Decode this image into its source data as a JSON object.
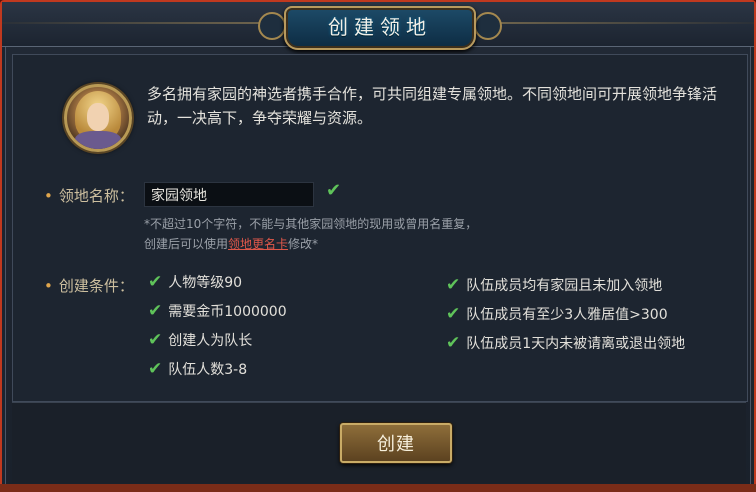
{
  "title": "创建领地",
  "intro": "多名拥有家园的神选者携手合作，可共同组建专属领地。不同领地间可开展领地争锋活动，一决高下，争夺荣耀与资源。",
  "name_field": {
    "label": "领地名称：",
    "value": "家园领地"
  },
  "note": {
    "line1": "*不超过10个字符，不能与其他家园领地的现用或曾用名重复，",
    "line2_prefix": "创建后可以使用",
    "line2_link": "领地更名卡",
    "line2_suffix": "修改*"
  },
  "conditions_label": "创建条件：",
  "conditions_left": [
    "人物等级90",
    "需要金币1000000",
    "创建人为队长",
    "队伍人数3-8"
  ],
  "conditions_right": [
    "队伍成员均有家园且未加入领地",
    "队伍成员有至少3人雅居值>300",
    "队伍成员1天内未被请离或退出领地"
  ],
  "create_button": "创建",
  "colors": {
    "frame": "#c0391f",
    "check": "#5fc35a",
    "label": "#cdbf9f",
    "link": "#e0584a",
    "button_gold": "#c9ab66"
  }
}
